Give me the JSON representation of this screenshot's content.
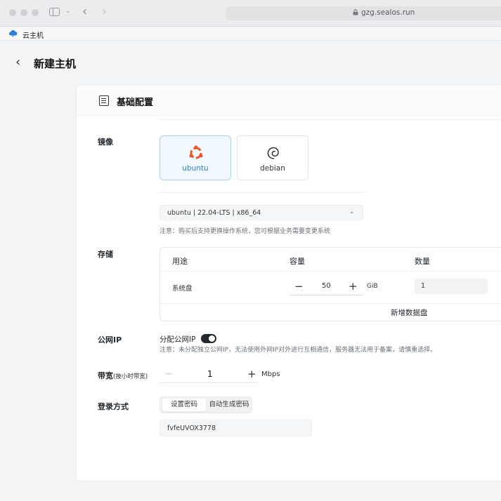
{
  "browser": {
    "url": "gzg.sealos.run",
    "tab_title": "云主机"
  },
  "page": {
    "title": "新建主机"
  },
  "section": {
    "title": "基础配置"
  },
  "image": {
    "label": "镜像",
    "options": [
      {
        "name": "ubuntu",
        "selected": true
      },
      {
        "name": "debian",
        "selected": false
      }
    ],
    "version_selected": "ubuntu | 22.04-LTS | x86_64",
    "note": "注意：购买后支持更换操作系统，您可根据业务需要变更系统"
  },
  "storage": {
    "label": "存储",
    "columns": [
      "用途",
      "容量",
      "数量"
    ],
    "rows": [
      {
        "usage": "系统盘",
        "capacity": "50",
        "unit": "GiB",
        "quantity": "1"
      }
    ],
    "add_disk": "新增数据盘"
  },
  "public_ip": {
    "label": "公网IP",
    "toggle_label": "分配公网IP",
    "enabled": true,
    "note": "注意：未分配独立公网IP，无法使用外网IP对外进行互相通信，服务器无法用于备案，请慎重选择。"
  },
  "bandwidth": {
    "label": "带宽",
    "label_hint": "(按小时带宽)",
    "value": "1",
    "unit": "Mbps"
  },
  "login": {
    "label": "登录方式",
    "options": [
      "设置密码",
      "自动生成密码"
    ],
    "selected": "设置密码",
    "password": "fvfeUVOX3778"
  },
  "colors": {
    "accent": "#2f7fd6",
    "ubuntu": "#e95420",
    "toggle_on": "#24282c"
  }
}
